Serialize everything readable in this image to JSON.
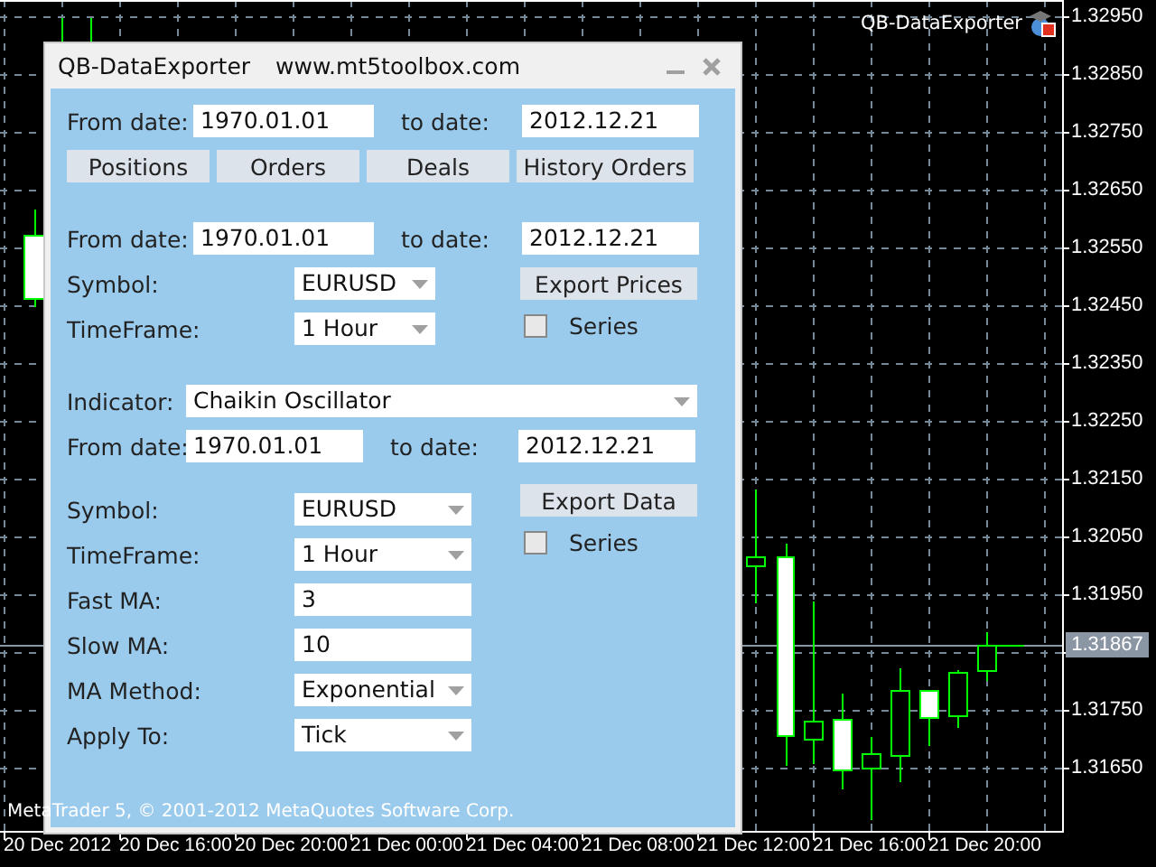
{
  "chart": {
    "expert_label": "QB-DataExporter",
    "price_axis": [
      {
        "text": "1.32950",
        "kind": "tick"
      },
      {
        "text": "1.32850",
        "kind": "tick"
      },
      {
        "text": "1.32750",
        "kind": "tick"
      },
      {
        "text": "1.32650",
        "kind": "tick"
      },
      {
        "text": "1.32550",
        "kind": "tick"
      },
      {
        "text": "1.32450",
        "kind": "tick"
      },
      {
        "text": "1.32350",
        "kind": "tick"
      },
      {
        "text": "1.32250",
        "kind": "tick"
      },
      {
        "text": "1.32150",
        "kind": "tick"
      },
      {
        "text": "1.32050",
        "kind": "tick"
      },
      {
        "text": "1.31950",
        "kind": "tick"
      },
      {
        "text": "1.31867",
        "kind": "current"
      },
      {
        "text": "1.31750",
        "kind": "tick"
      },
      {
        "text": "1.31650",
        "kind": "tick"
      }
    ],
    "time_labels": [
      "20 Dec 2012",
      "20 Dec 16:00",
      "20 Dec 20:00",
      "21 Dec 00:00",
      "21 Dec 04:00",
      "21 Dec 08:00",
      "21 Dec 12:00",
      "21 Dec 16:00",
      "21 Dec 20:00"
    ],
    "copyright": "MetaTrader 5, © 2001-2012 MetaQuotes Software Corp."
  },
  "dialog": {
    "title": "QB-DataExporter",
    "url": "www.mt5toolbox.com",
    "trades": {
      "from_label": "From date:",
      "from_value": "1970.01.01",
      "to_label": "to date:",
      "to_value": "2012.12.21",
      "buttons": [
        "Positions",
        "Orders",
        "Deals",
        "History Orders"
      ]
    },
    "prices": {
      "from_label": "From date:",
      "from_value": "1970.01.01",
      "to_label": "to date:",
      "to_value": "2012.12.21",
      "params": [
        {
          "label": "Symbol:",
          "value": "EURUSD",
          "kind": "combo"
        },
        {
          "label": "TimeFrame:",
          "value": "1 Hour",
          "kind": "combo"
        }
      ],
      "export_button": "Export Prices",
      "series": {
        "label": "Series",
        "checked": false
      }
    },
    "indicator": {
      "indicator_label": "Indicator:",
      "indicator_value": "Chaikin Oscillator",
      "from_label": "From date:",
      "from_value": "1970.01.01",
      "to_label": "to date:",
      "to_value": "2012.12.21",
      "params": [
        {
          "label": "Symbol:",
          "value": "EURUSD",
          "kind": "combo"
        },
        {
          "label": "TimeFrame:",
          "value": "1 Hour",
          "kind": "combo"
        },
        {
          "label": "Fast MA:",
          "value": "3",
          "kind": "input"
        },
        {
          "label": "Slow MA:",
          "value": "10",
          "kind": "input"
        },
        {
          "label": "MA Method:",
          "value": "Exponential",
          "kind": "combo"
        },
        {
          "label": "Apply To:",
          "value": "Tick",
          "kind": "combo"
        }
      ],
      "export_button": "Export Data",
      "series": {
        "label": "Series",
        "checked": false
      }
    }
  }
}
